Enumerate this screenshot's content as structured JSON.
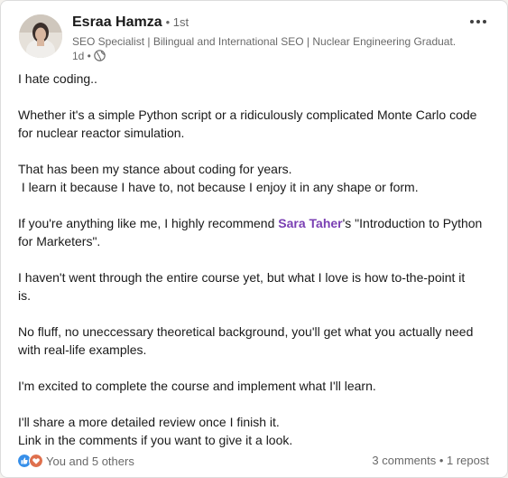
{
  "post": {
    "author": {
      "name": "Esraa Hamza",
      "degree": "• 1st",
      "headline": "SEO Specialist | Bilingual and International SEO | Nuclear Engineering Graduat...",
      "time": "1d •"
    },
    "body": {
      "p1": "I hate coding..",
      "p2_l1": "Whether it's a simple Python script or a ridiculously complicated Monte Carlo code",
      "p2_l2": "for nuclear reactor simulation.",
      "p3_l1": "That has been my stance about coding for years.",
      "p3_l2": " I learn it because I have to, not because I enjoy it in any shape or form.",
      "p4_pre": "If you're anything like me, I highly recommend ",
      "p4_mention": "Sara Taher",
      "p4_post": "'s \"Introduction to Python",
      "p4_l2": "for Marketers\".",
      "p5_l1": "I haven't went through the entire course yet, but what I love is how to-the-point it",
      "p5_l2": "is.",
      "p6_l1": "No fluff, no uneccessary theoretical background, you'll get what you actually need",
      "p6_l2": "with real-life examples.",
      "p7": "I'm excited to complete the course and implement what I'll learn.",
      "p8_l1": "I'll share a more detailed review once I finish it.",
      "p8_l2": "Link in the comments if you want to give it a look."
    },
    "social": {
      "reactions": "You and 5 others",
      "comments": "3 comments",
      "separator": " • ",
      "reposts": "1 repost"
    }
  },
  "colors": {
    "mention": "#7a3fb3",
    "like": "#378fe9",
    "love": "#df704d"
  },
  "icons": [
    "globe-icon",
    "more-icon",
    "like-reaction-icon",
    "love-reaction-icon"
  ]
}
